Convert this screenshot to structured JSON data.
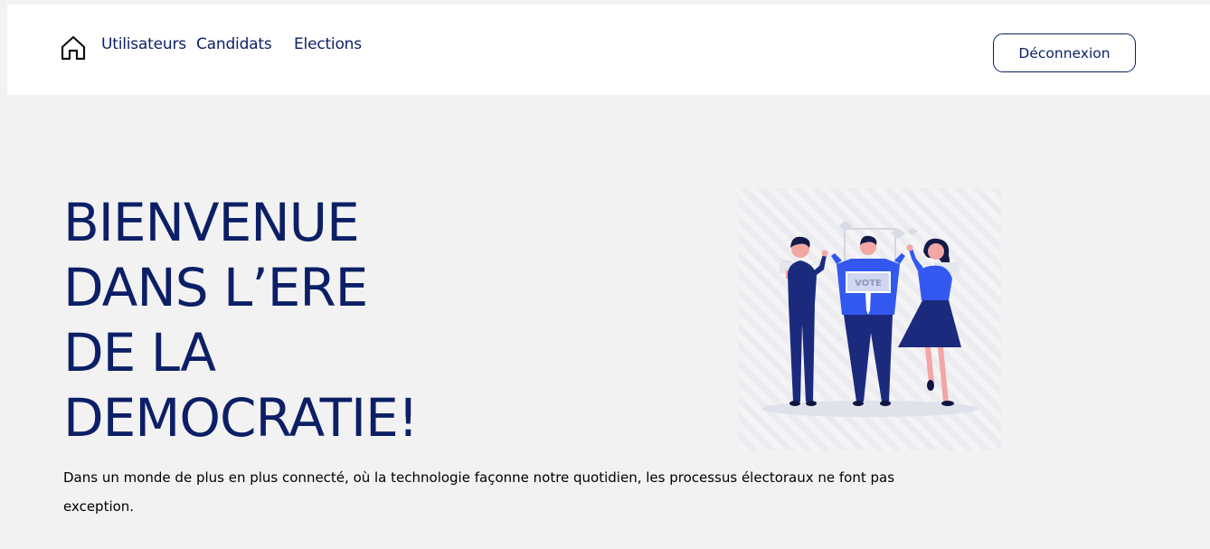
{
  "nav": {
    "home_icon": "home-icon",
    "links": [
      "Utilisateurs",
      "Candidats",
      "Elections"
    ],
    "logout_label": "Déconnexion"
  },
  "hero": {
    "title_lines": [
      "BIENVENUE",
      "DANS L’ERE",
      "DE LA",
      "DEMOCRATIE!"
    ],
    "text": "Dans un monde de plus en plus connecté, où la technologie façonne notre quotidien, les processus électoraux ne font pas exception.",
    "illustration": {
      "sign_text": "VOTE"
    }
  },
  "colors": {
    "primary": "#0c1f66",
    "accent_blue": "#2f5bf0",
    "background": "#f2f2f2",
    "header_bg": "#ffffff"
  }
}
